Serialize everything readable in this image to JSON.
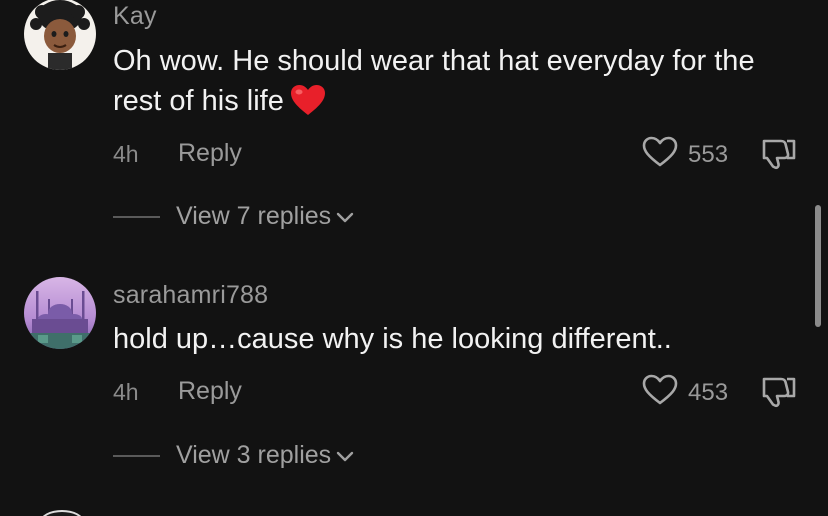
{
  "comments": [
    {
      "username": "Kay",
      "text": "Oh wow. He should wear that hat everyday for the rest of his life",
      "emoji": "red-heart",
      "time": "4h",
      "reply_label": "Reply",
      "likes": "553",
      "view_replies": "View 7 replies"
    },
    {
      "username": "sarahamri788",
      "text": "hold up…cause why is he looking different..",
      "time": "4h",
      "reply_label": "Reply",
      "likes": "453",
      "view_replies": "View 3 replies"
    }
  ],
  "colors": {
    "background": "#121212",
    "primary_text": "#f2f2f2",
    "secondary_text": "#9a9a9a",
    "heart_red": "#e8202a"
  },
  "icons": [
    "heart-outline-icon",
    "thumbs-down-icon",
    "chevron-down-icon",
    "red-heart-emoji"
  ]
}
